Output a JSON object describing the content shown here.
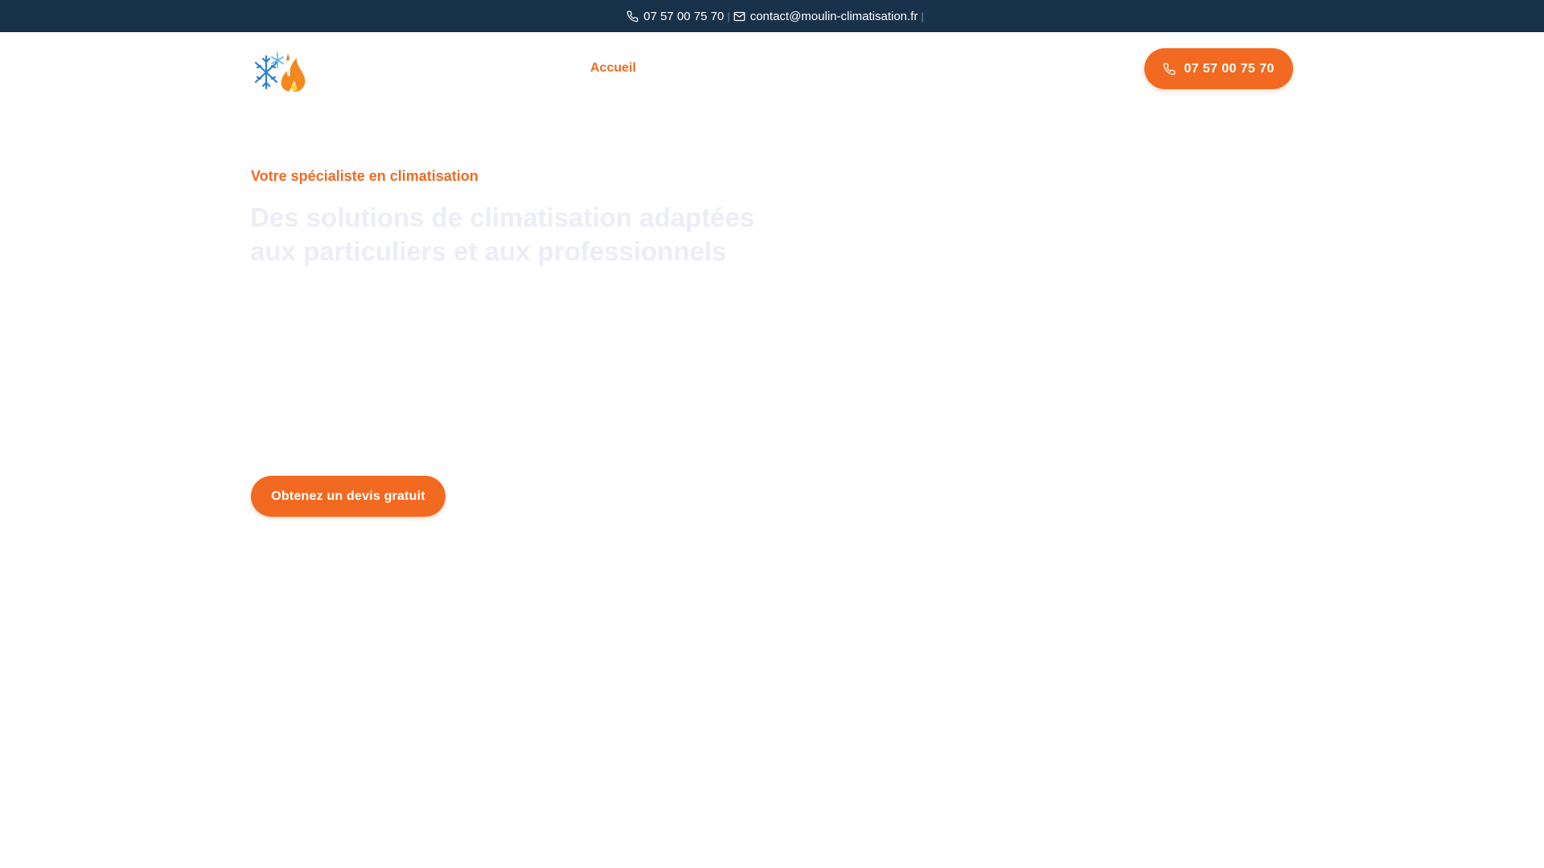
{
  "topbar": {
    "phone": "07 57 00 75 70",
    "email": "contact@moulin-climatisation.fr",
    "separator": "|",
    "background": "#18324a"
  },
  "header": {
    "logo_icon": "snowflake-flame-logo",
    "nav": [
      {
        "label": "Accueil",
        "active": true
      }
    ],
    "cta_phone": "07 57 00 75 70"
  },
  "hero": {
    "eyebrow": "Votre spécialiste en climatisation",
    "title": "Des solutions de climatisation adaptées aux particuliers et aux professionnels",
    "cta": "Obtenez un devis gratuit"
  },
  "colors": {
    "accent": "#f26a21",
    "topbar": "#18324a",
    "title": "#ecedf5"
  }
}
